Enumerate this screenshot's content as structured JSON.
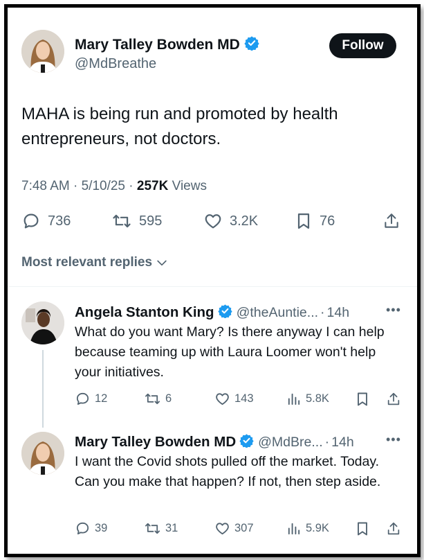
{
  "post": {
    "author_name": "Mary Talley Bowden MD",
    "author_handle": "@MdBreathe",
    "follow_label": "Follow",
    "text": "MAHA is being run and promoted by health entrepreneurs, not doctors.",
    "time": "7:48 AM",
    "date": "5/10/25",
    "views_count": "257K",
    "views_label": "Views",
    "replies": "736",
    "reposts": "595",
    "likes": "3.2K",
    "bookmarks": "76"
  },
  "replies_header": {
    "label": "Most relevant replies"
  },
  "replies": [
    {
      "author_name": "Angela Stanton King",
      "author_handle": "@theAuntie...",
      "age": "14h",
      "text": "What do you want Mary? Is there anyway I can help because teaming up with Laura Loomer won't help your initiatives.",
      "replies": "12",
      "reposts": "6",
      "likes": "143",
      "views": "5.8K"
    },
    {
      "author_name": "Mary Talley Bowden MD",
      "author_handle": "@MdBre...",
      "age": "14h",
      "text": "I want the Covid shots pulled off the market. Today.  Can you make that happen?  If not, then step aside.",
      "replies": "39",
      "reposts": "31",
      "likes": "307",
      "views": "5.9K"
    }
  ],
  "colors": {
    "text": "#0f1419",
    "secondary": "#536471",
    "verified": "#1d9bf0",
    "divider": "#eff3f4"
  },
  "icons": [
    "verified-badge-icon",
    "reply-icon",
    "repost-icon",
    "like-icon",
    "bookmark-icon",
    "share-icon",
    "views-icon",
    "chevron-down-icon",
    "more-icon"
  ]
}
